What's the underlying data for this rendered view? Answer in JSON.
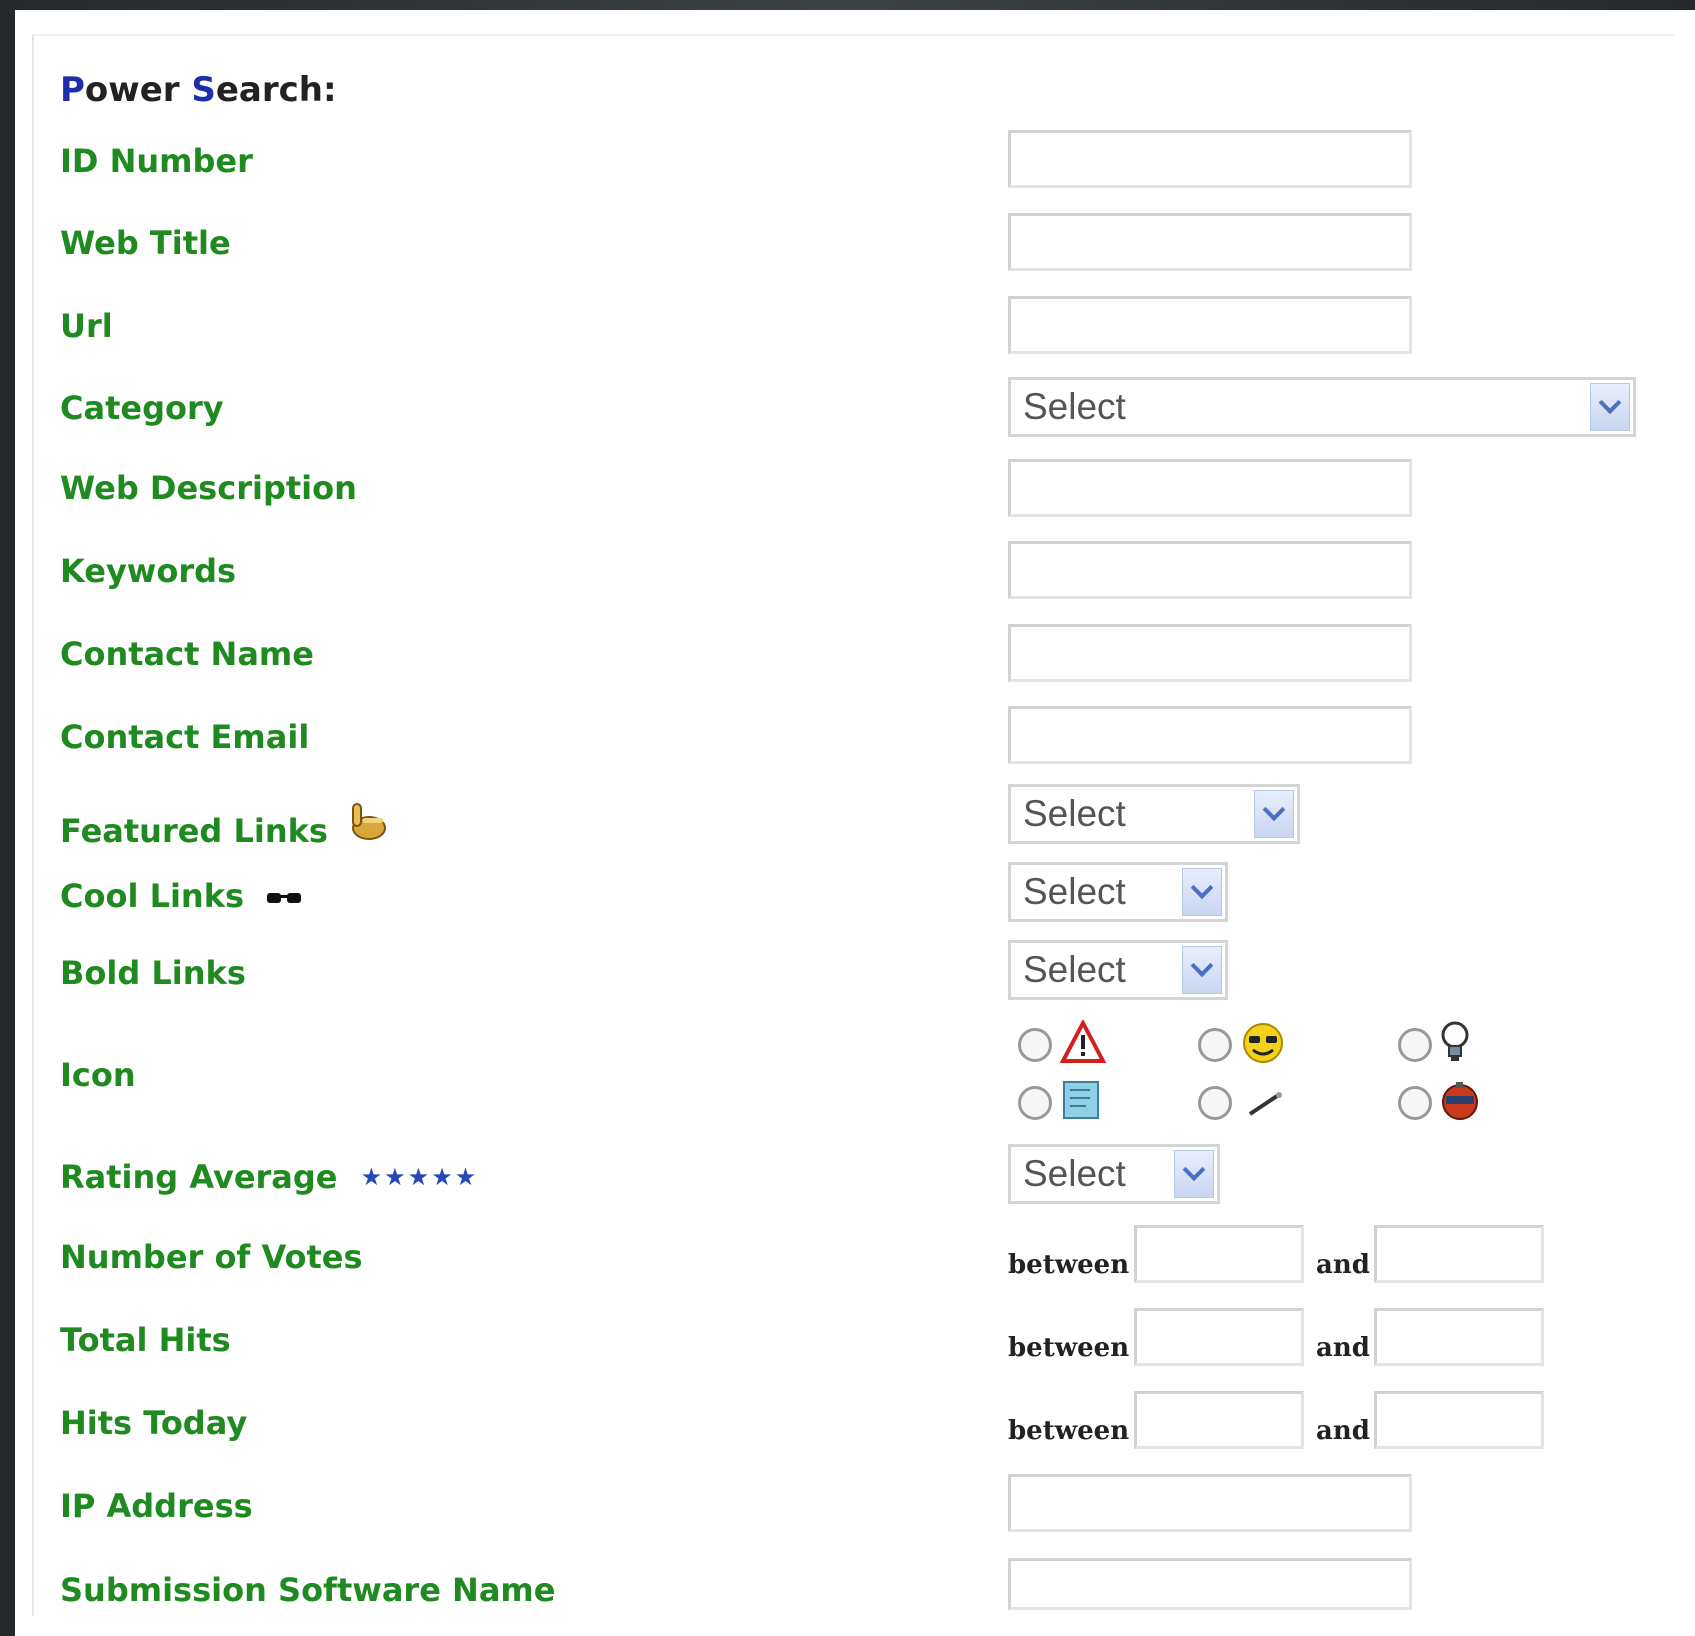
{
  "title": {
    "p_cap": "P",
    "rest1": "ower ",
    "s_cap": "S",
    "rest2": "earch:"
  },
  "labels": {
    "id_number": "ID Number",
    "web_title": "Web Title",
    "url": "Url",
    "category": "Category",
    "web_description": "Web Description",
    "keywords": "Keywords",
    "contact_name": "Contact Name",
    "contact_email": "Contact Email",
    "featured_links": "Featured Links",
    "cool_links": "Cool Links",
    "bold_links": "Bold Links",
    "icon": "Icon",
    "rating_average": "Rating Average",
    "number_of_votes": "Number of Votes",
    "total_hits": "Total Hits",
    "hits_today": "Hits Today",
    "ip_address": "IP Address",
    "submission_software_name": "Submission Software Name"
  },
  "selects": {
    "category": "Select",
    "featured_links": "Select",
    "cool_links": "Select",
    "bold_links": "Select",
    "rating_average": "Select"
  },
  "range": {
    "between": "between",
    "and": "and"
  },
  "icons": {
    "featured": "pointing-hand-icon",
    "cool": "sunglasses-icon",
    "rating_stars": "★★★★★",
    "options": [
      "warning-triangle-icon",
      "cool-smiley-icon",
      "lightbulb-icon",
      "map-icon",
      "pen-icon",
      "bomb-icon"
    ]
  },
  "colors": {
    "label": "#1f8a1f",
    "title_caps": "#1d2fa8",
    "stars": "#2748b8"
  }
}
